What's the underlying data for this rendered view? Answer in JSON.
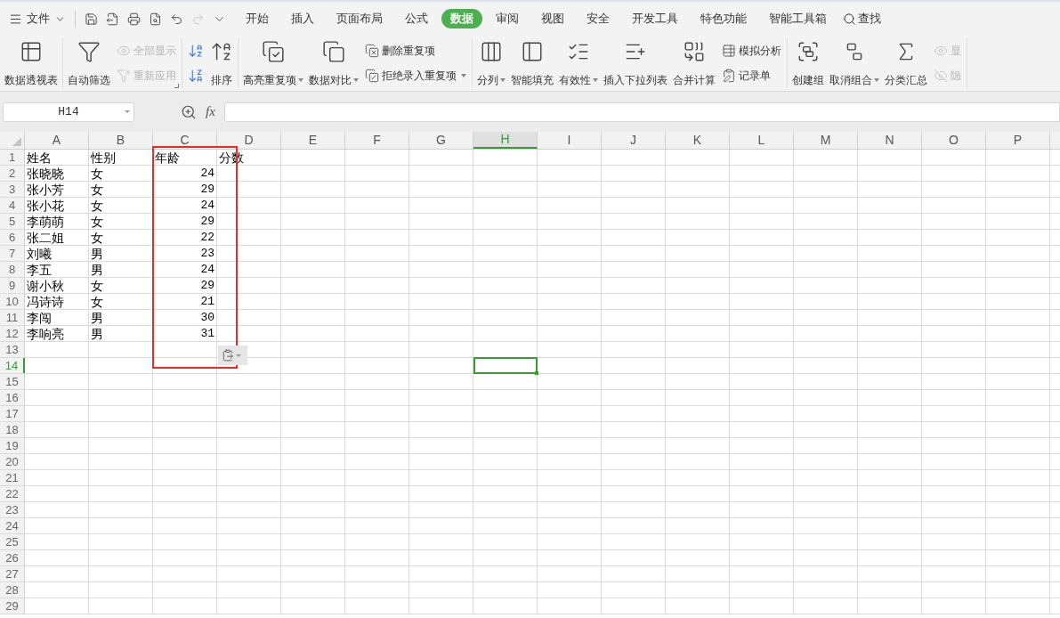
{
  "title_bar": {
    "menu": "文件",
    "quick_access": [
      {
        "kind": "save",
        "disabled": false
      },
      {
        "kind": "export",
        "disabled": false
      },
      {
        "kind": "print",
        "disabled": false
      },
      {
        "kind": "preview",
        "disabled": false
      },
      {
        "kind": "undo",
        "disabled": false
      },
      {
        "kind": "redo",
        "disabled": true
      },
      {
        "kind": "more",
        "disabled": false
      }
    ],
    "tabs": [
      {
        "label": "开始",
        "selected": false
      },
      {
        "label": "插入",
        "selected": false
      },
      {
        "label": "页面布局",
        "selected": false
      },
      {
        "label": "公式",
        "selected": false
      },
      {
        "label": "数据",
        "selected": true
      },
      {
        "label": "审阅",
        "selected": false
      },
      {
        "label": "视图",
        "selected": false
      },
      {
        "label": "安全",
        "selected": false
      },
      {
        "label": "开发工具",
        "selected": false
      },
      {
        "label": "特色功能",
        "selected": false
      },
      {
        "label": "智能工具箱",
        "selected": false
      }
    ],
    "search": "查找"
  },
  "ribbon": {
    "groups": [
      {
        "items": [
          {
            "kind": "large",
            "label": "数据透视表",
            "dropdown": false,
            "disabled": false
          }
        ]
      },
      {
        "launcher": true,
        "items": [
          {
            "kind": "large",
            "label": "自动筛选",
            "dropdown": false,
            "disabled": false
          },
          {
            "kind": "stack",
            "entries": [
              {
                "label": "全部显示",
                "dropdown": false,
                "disabled": true
              },
              {
                "label": "重新应用",
                "dropdown": false,
                "disabled": true
              }
            ]
          }
        ]
      },
      {
        "items": [
          {
            "kind": "icons",
            "entries": [
              {
                "disabled": false
              },
              {
                "disabled": false
              }
            ]
          },
          {
            "kind": "large",
            "label": "排序",
            "dropdown": false,
            "disabled": false
          }
        ]
      },
      {
        "items": [
          {
            "kind": "large",
            "label": "高亮重复项",
            "dropdown": true,
            "disabled": false
          },
          {
            "kind": "large",
            "label": "数据对比",
            "dropdown": true,
            "disabled": false
          },
          {
            "kind": "stack",
            "entries": [
              {
                "label": "删除重复项",
                "dropdown": false,
                "disabled": false
              },
              {
                "label": "拒绝录入重复项",
                "dropdown": true,
                "disabled": false
              }
            ]
          }
        ]
      },
      {
        "items": [
          {
            "kind": "large",
            "label": "分列",
            "dropdown": true,
            "disabled": false
          },
          {
            "kind": "large",
            "label": "智能填充",
            "dropdown": false,
            "disabled": false
          },
          {
            "kind": "large",
            "label": "有效性",
            "dropdown": true,
            "disabled": false
          },
          {
            "kind": "large",
            "label": "插入下拉列表",
            "dropdown": false,
            "disabled": false
          },
          {
            "kind": "large",
            "label": "合并计算",
            "dropdown": false,
            "disabled": false
          },
          {
            "kind": "stack",
            "entries": [
              {
                "label": "模拟分析",
                "dropdown": false,
                "disabled": false
              },
              {
                "label": "记录单",
                "dropdown": false,
                "disabled": false
              }
            ]
          }
        ]
      },
      {
        "items": [
          {
            "kind": "large",
            "label": "创建组",
            "dropdown": false,
            "disabled": false
          },
          {
            "kind": "large",
            "label": "取消组合",
            "dropdown": true,
            "disabled": false
          },
          {
            "kind": "large",
            "label": "分类汇总",
            "dropdown": false,
            "disabled": false
          },
          {
            "kind": "stack",
            "entries": [
              {
                "label": "显",
                "dropdown": false,
                "disabled": true
              },
              {
                "label": "隐",
                "dropdown": false,
                "disabled": true
              }
            ]
          }
        ]
      }
    ]
  },
  "formula_bar": {
    "name_box": "H14",
    "function_label": "fx"
  },
  "sheet": {
    "columns": [
      {
        "label": "A",
        "selected": false
      },
      {
        "label": "B",
        "selected": false
      },
      {
        "label": "C",
        "selected": false
      },
      {
        "label": "D",
        "selected": false
      },
      {
        "label": "E",
        "selected": false
      },
      {
        "label": "F",
        "selected": false
      },
      {
        "label": "G",
        "selected": false
      },
      {
        "label": "H",
        "selected": true
      },
      {
        "label": "I",
        "selected": false
      },
      {
        "label": "J",
        "selected": false
      },
      {
        "label": "K",
        "selected": false
      },
      {
        "label": "L",
        "selected": false
      },
      {
        "label": "M",
        "selected": false
      },
      {
        "label": "N",
        "selected": false
      },
      {
        "label": "O",
        "selected": false
      },
      {
        "label": "P",
        "selected": false
      }
    ],
    "rows": [
      {
        "number": "1",
        "selected": false,
        "cells": [
          {
            "text": "姓名",
            "kind": "text"
          },
          {
            "text": "性别",
            "kind": "text"
          },
          {
            "text": "年龄",
            "kind": "text"
          },
          {
            "text": "分数",
            "kind": "text"
          }
        ]
      },
      {
        "number": "2",
        "selected": false,
        "cells": [
          {
            "text": "张晓晓",
            "kind": "text"
          },
          {
            "text": "女",
            "kind": "text"
          },
          {
            "text": "24",
            "kind": "number"
          }
        ]
      },
      {
        "number": "3",
        "selected": false,
        "cells": [
          {
            "text": "张小芳",
            "kind": "text"
          },
          {
            "text": "女",
            "kind": "text"
          },
          {
            "text": "29",
            "kind": "number"
          }
        ]
      },
      {
        "number": "4",
        "selected": false,
        "cells": [
          {
            "text": "张小花",
            "kind": "text"
          },
          {
            "text": "女",
            "kind": "text"
          },
          {
            "text": "24",
            "kind": "number"
          }
        ]
      },
      {
        "number": "5",
        "selected": false,
        "cells": [
          {
            "text": "李萌萌",
            "kind": "text"
          },
          {
            "text": "女",
            "kind": "text"
          },
          {
            "text": "29",
            "kind": "number"
          }
        ]
      },
      {
        "number": "6",
        "selected": false,
        "cells": [
          {
            "text": "张二姐",
            "kind": "text"
          },
          {
            "text": "女",
            "kind": "text"
          },
          {
            "text": "22",
            "kind": "number"
          }
        ]
      },
      {
        "number": "7",
        "selected": false,
        "cells": [
          {
            "text": "刘曦",
            "kind": "text"
          },
          {
            "text": "男",
            "kind": "text"
          },
          {
            "text": "23",
            "kind": "number"
          }
        ]
      },
      {
        "number": "8",
        "selected": false,
        "cells": [
          {
            "text": "李五",
            "kind": "text"
          },
          {
            "text": "男",
            "kind": "text"
          },
          {
            "text": "24",
            "kind": "number"
          }
        ]
      },
      {
        "number": "9",
        "selected": false,
        "cells": [
          {
            "text": "谢小秋",
            "kind": "text"
          },
          {
            "text": "女",
            "kind": "text"
          },
          {
            "text": "29",
            "kind": "number"
          }
        ]
      },
      {
        "number": "10",
        "selected": false,
        "cells": [
          {
            "text": "冯诗诗",
            "kind": "text"
          },
          {
            "text": "女",
            "kind": "text"
          },
          {
            "text": "21",
            "kind": "number"
          }
        ]
      },
      {
        "number": "11",
        "selected": false,
        "cells": [
          {
            "text": "李闯",
            "kind": "text"
          },
          {
            "text": "男",
            "kind": "text"
          },
          {
            "text": "30",
            "kind": "number"
          }
        ]
      },
      {
        "number": "12",
        "selected": false,
        "cells": [
          {
            "text": "李响亮",
            "kind": "text"
          },
          {
            "text": "男",
            "kind": "text"
          },
          {
            "text": "31",
            "kind": "number"
          }
        ]
      },
      {
        "number": "13",
        "selected": false
      },
      {
        "number": "14",
        "selected": true
      },
      {
        "number": "15",
        "selected": false
      },
      {
        "number": "16",
        "selected": false
      },
      {
        "number": "17",
        "selected": false
      },
      {
        "number": "18",
        "selected": false
      },
      {
        "number": "19",
        "selected": false
      },
      {
        "number": "20",
        "selected": false
      },
      {
        "number": "21",
        "selected": false
      },
      {
        "number": "22",
        "selected": false
      },
      {
        "number": "23",
        "selected": false
      },
      {
        "number": "24",
        "selected": false
      },
      {
        "number": "25",
        "selected": false
      },
      {
        "number": "26",
        "selected": false
      },
      {
        "number": "27",
        "selected": false
      },
      {
        "number": "28",
        "selected": false
      },
      {
        "number": "29",
        "selected": false
      }
    ]
  }
}
